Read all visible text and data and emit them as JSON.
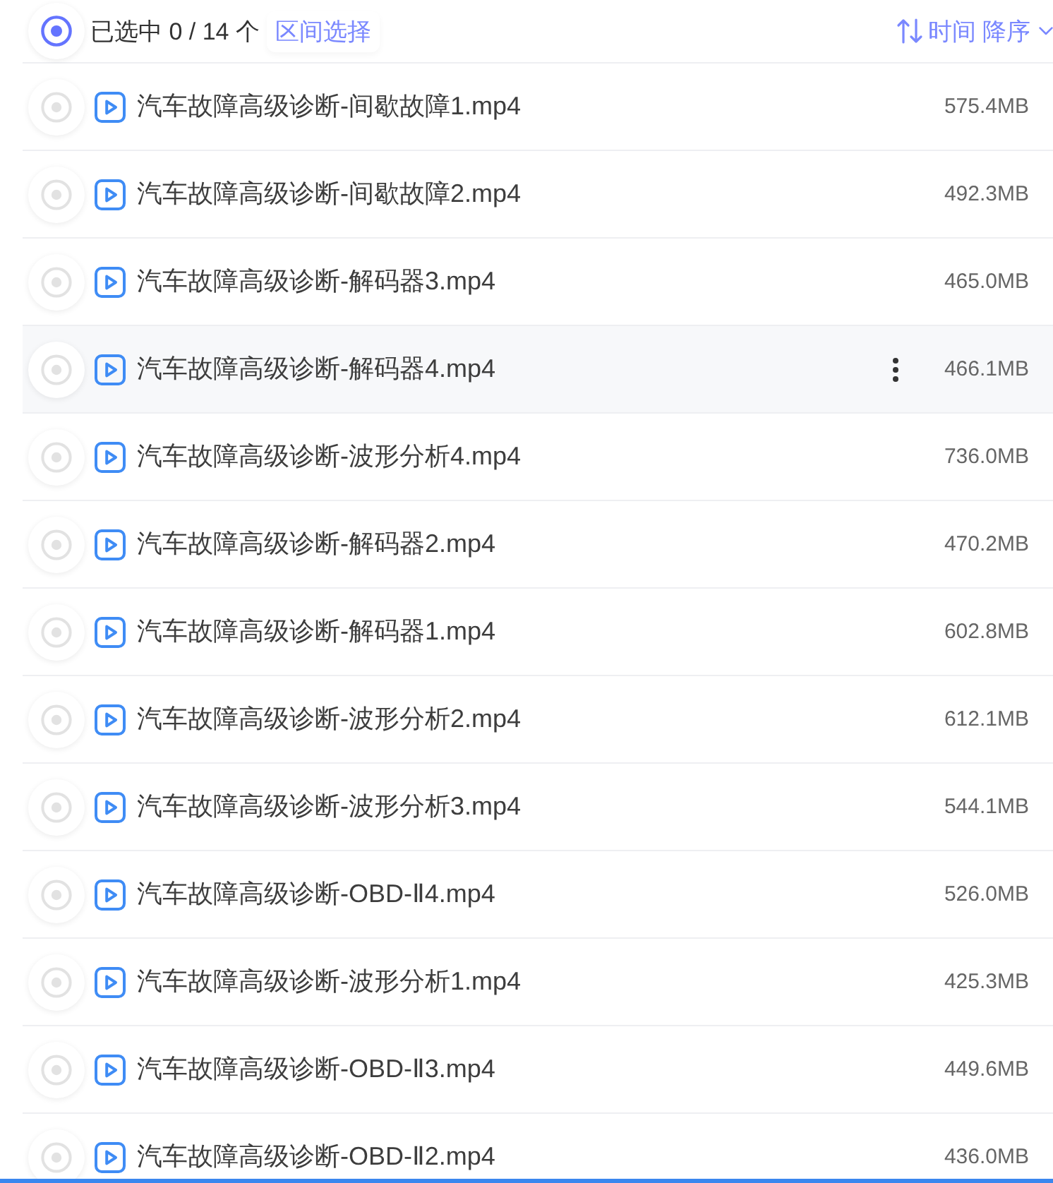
{
  "header": {
    "selection_text": "已选中 0 / 14 个",
    "range_select": "区间选择",
    "sort": {
      "field": "时间",
      "order": "降序"
    }
  },
  "files": [
    {
      "name": "汽车故障高级诊断-间歇故障1.mp4",
      "size": "575.4MB",
      "selected": false,
      "hovered": false
    },
    {
      "name": "汽车故障高级诊断-间歇故障2.mp4",
      "size": "492.3MB",
      "selected": false,
      "hovered": false
    },
    {
      "name": "汽车故障高级诊断-解码器3.mp4",
      "size": "465.0MB",
      "selected": false,
      "hovered": false
    },
    {
      "name": "汽车故障高级诊断-解码器4.mp4",
      "size": "466.1MB",
      "selected": false,
      "hovered": true
    },
    {
      "name": "汽车故障高级诊断-波形分析4.mp4",
      "size": "736.0MB",
      "selected": false,
      "hovered": false
    },
    {
      "name": "汽车故障高级诊断-解码器2.mp4",
      "size": "470.2MB",
      "selected": false,
      "hovered": false
    },
    {
      "name": "汽车故障高级诊断-解码器1.mp4",
      "size": "602.8MB",
      "selected": false,
      "hovered": false
    },
    {
      "name": "汽车故障高级诊断-波形分析2.mp4",
      "size": "612.1MB",
      "selected": false,
      "hovered": false
    },
    {
      "name": "汽车故障高级诊断-波形分析3.mp4",
      "size": "544.1MB",
      "selected": false,
      "hovered": false
    },
    {
      "name": "汽车故障高级诊断-OBD-Ⅱ4.mp4",
      "size": "526.0MB",
      "selected": false,
      "hovered": false
    },
    {
      "name": "汽车故障高级诊断-波形分析1.mp4",
      "size": "425.3MB",
      "selected": false,
      "hovered": false
    },
    {
      "name": "汽车故障高级诊断-OBD-Ⅱ3.mp4",
      "size": "449.6MB",
      "selected": false,
      "hovered": false
    },
    {
      "name": "汽车故障高级诊断-OBD-Ⅱ2.mp4",
      "size": "436.0MB",
      "selected": false,
      "hovered": false
    }
  ]
}
